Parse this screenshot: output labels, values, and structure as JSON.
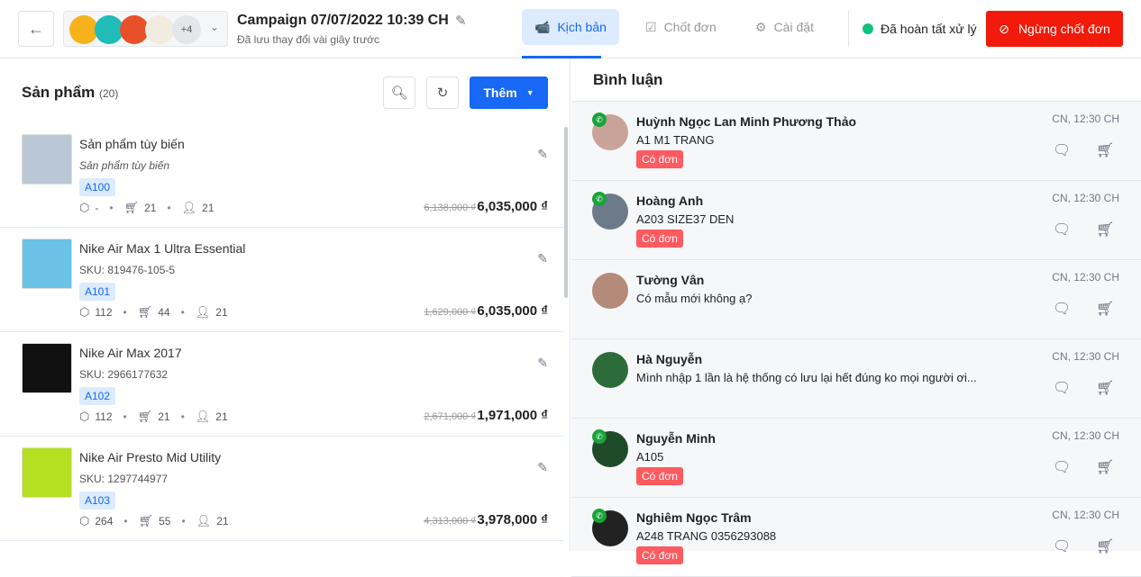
{
  "header": {
    "back_icon": "arrow-left-icon",
    "pages_more": "+4",
    "title": "Campaign 07/07/2022 10:39 CH",
    "subtitle": "Đã lưu thay đổi vài giây trước",
    "tabs": [
      {
        "label": "Kịch bản",
        "icon": "live-camera-icon",
        "active": true
      },
      {
        "label": "Chốt đơn",
        "icon": "checklist-icon"
      },
      {
        "label": "Cài đặt",
        "icon": "gear-icon"
      }
    ],
    "status": "Đã hoàn tất xử lý",
    "stop_label": "Ngừng chốt đơn",
    "colors": {
      "accent": "#1668f5",
      "danger": "#f21a0a",
      "ok": "#10c27a"
    }
  },
  "products": {
    "title": "Sản phẩm",
    "count": "(20)",
    "add_label": "Thêm",
    "items": [
      {
        "name": "Sản phẩm tùy biến",
        "sku": "Sản phẩm tùy biến",
        "code": "A100",
        "stock": "-",
        "cart": "21",
        "buyers": "21",
        "old_price": "6,138,000 ₫",
        "price": "6,035,000 ₫"
      },
      {
        "name": "Nike Air Max 1 Ultra Essential",
        "sku": "SKU: 819476-105-5",
        "code": "A101",
        "stock": "112",
        "cart": "44",
        "buyers": "21",
        "old_price": "1,629,000 ₫",
        "price": "6,035,000 ₫"
      },
      {
        "name": "Nike Air Max 2017",
        "sku": "SKU: 2966177632",
        "code": "A102",
        "stock": "112",
        "cart": "21",
        "buyers": "21",
        "old_price": "2,671,000 ₫",
        "price": "1,971,000 ₫"
      },
      {
        "name": "Nike Air Presto Mid Utility",
        "sku": "SKU: 1297744977",
        "code": "A103",
        "stock": "264",
        "cart": "55",
        "buyers": "21",
        "old_price": "4,313,000 ₫",
        "price": "3,978,000 ₫"
      }
    ]
  },
  "comments": {
    "title": "Bình luận",
    "items": [
      {
        "name": "Huỳnh Ngọc Lan Minh Phương Thảo",
        "text": "A1 M1 TRANG",
        "tag": "Có đơn",
        "time": "CN, 12:30 CH",
        "phone": true
      },
      {
        "name": "Hoàng Anh",
        "text": "A203 SIZE37 DEN",
        "tag": "Có đơn",
        "time": "CN, 12:30 CH",
        "phone": true
      },
      {
        "name": "Tường Vân",
        "text": "Có mẫu mới không ạ?",
        "time": "CN, 12:30 CH"
      },
      {
        "name": "Hà Nguyễn",
        "text": "Mình nhập 1 lần là hệ thống có lưu lại hết đúng ko mọi người ơi...",
        "time": "CN, 12:30 CH"
      },
      {
        "name": "Nguyễn Minh",
        "text": "A105",
        "tag": "Có đơn",
        "time": "CN, 12:30 CH",
        "phone": true
      },
      {
        "name": "Nghiêm Ngọc Trâm",
        "text": "A248 TRANG 0356293088",
        "tag": "Có đơn",
        "time": "CN, 12:30 CH",
        "phone": true
      }
    ]
  }
}
